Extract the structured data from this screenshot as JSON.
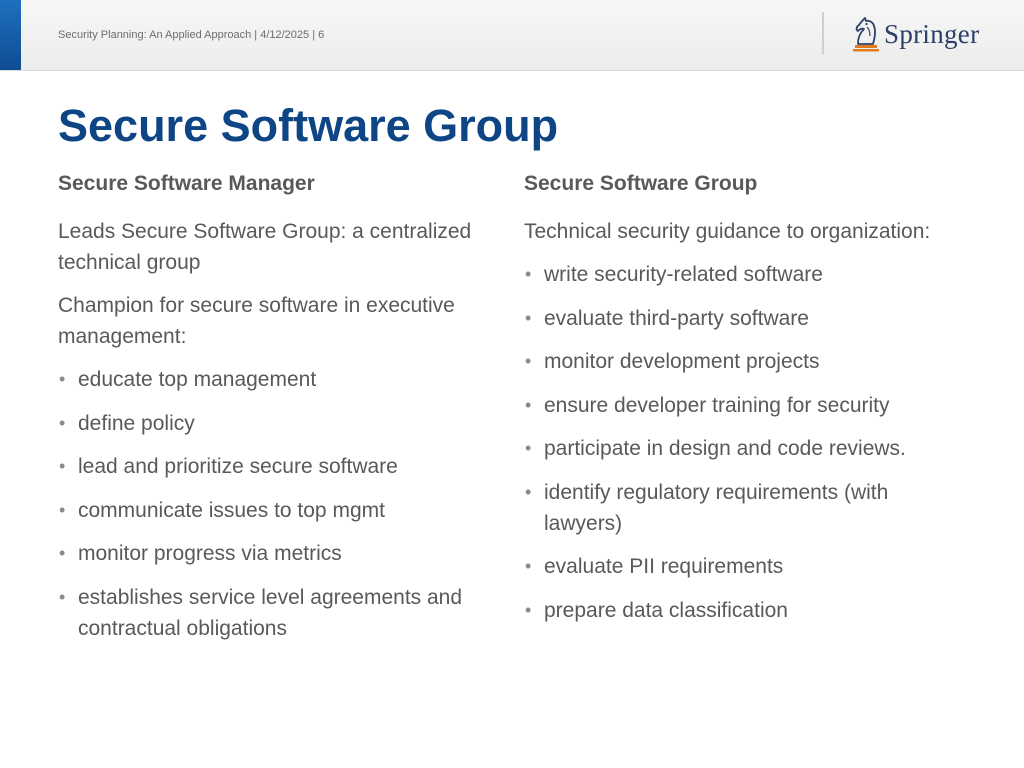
{
  "header": {
    "footer_text": "Security Planning: An Applied Approach | 4/12/2025 | 6",
    "logo_text": "Springer",
    "logo_icon": "springer-chess-knight-icon"
  },
  "title": "Secure Software Group",
  "left_column": {
    "heading": "Secure Software Manager",
    "paragraphs": [
      "Leads Secure Software Group: a centralized technical group",
      "Champion for secure software in executive management:"
    ],
    "bullets": [
      "educate top management",
      "define policy",
      "lead and prioritize secure software",
      "communicate issues to top mgmt",
      "monitor progress via metrics",
      "establishes service level agreements and contractual obligations"
    ]
  },
  "right_column": {
    "heading": "Secure Software Group",
    "paragraphs": [
      "Technical security guidance to organization:"
    ],
    "bullets": [
      "write security-related software",
      "evaluate third-party software",
      "monitor development projects",
      "ensure developer training for security",
      "participate in design and code reviews.",
      "identify regulatory requirements (with lawyers)",
      "evaluate PII requirements",
      "prepare data classification"
    ]
  },
  "colors": {
    "title": "#0d4585",
    "body_text": "#595959",
    "accent_bar": "#1f6fbf",
    "logo_text": "#2b3f66"
  }
}
